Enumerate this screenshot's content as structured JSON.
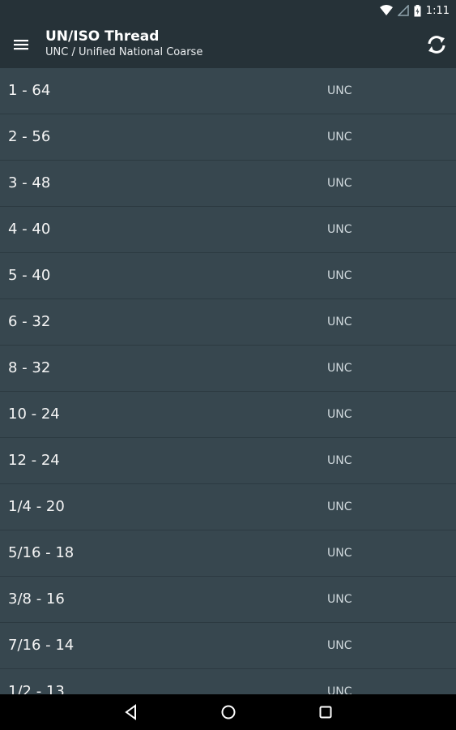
{
  "status_bar": {
    "time": "1:11",
    "icons": [
      "wifi-icon",
      "signal-icon",
      "battery-icon"
    ]
  },
  "toolbar": {
    "title": "UN/ISO Thread",
    "subtitle": "UNC / Unified National Coarse",
    "menu_icon": "hamburger-menu-icon",
    "refresh_icon": "refresh-icon"
  },
  "list": {
    "items": [
      {
        "label": "1 - 64",
        "type": "UNC"
      },
      {
        "label": "2 - 56",
        "type": "UNC"
      },
      {
        "label": "3 - 48",
        "type": "UNC"
      },
      {
        "label": "4 - 40",
        "type": "UNC"
      },
      {
        "label": "5 - 40",
        "type": "UNC"
      },
      {
        "label": "6 - 32",
        "type": "UNC"
      },
      {
        "label": "8 - 32",
        "type": "UNC"
      },
      {
        "label": "10 - 24",
        "type": "UNC"
      },
      {
        "label": "12 - 24",
        "type": "UNC"
      },
      {
        "label": "1/4 - 20",
        "type": "UNC"
      },
      {
        "label": "5/16 - 18",
        "type": "UNC"
      },
      {
        "label": "3/8 - 16",
        "type": "UNC"
      },
      {
        "label": "7/16 - 14",
        "type": "UNC"
      },
      {
        "label": "1/2 - 13",
        "type": "UNC"
      }
    ]
  },
  "nav_bar": {
    "icons": [
      "back-icon",
      "home-icon",
      "recents-icon"
    ]
  },
  "colors": {
    "toolbar_bg": "#263238",
    "list_bg": "#37474f",
    "divider": "#2c3a41",
    "nav_bg": "#000000"
  }
}
